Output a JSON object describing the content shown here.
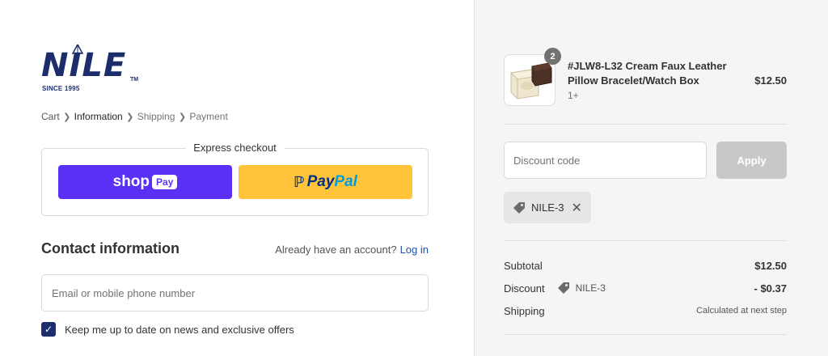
{
  "logo": {
    "word": "NILE",
    "tm": "TM",
    "since": "SINCE 1995"
  },
  "breadcrumb": [
    {
      "label": "Cart",
      "state": "link"
    },
    {
      "label": "Information",
      "state": "active"
    },
    {
      "label": "Shipping",
      "state": "muted"
    },
    {
      "label": "Payment",
      "state": "muted"
    }
  ],
  "express": {
    "title": "Express checkout",
    "shop_pay": {
      "word": "shop",
      "badge": "Pay"
    },
    "paypal": {
      "part1": "Pay",
      "part2": "Pal"
    }
  },
  "contact": {
    "title": "Contact information",
    "account_prompt": "Already have an account?",
    "login_label": "Log in",
    "email_placeholder": "Email or mobile phone number",
    "newsletter_label": "Keep me up to date on news and exclusive offers",
    "newsletter_checked": true
  },
  "order": {
    "product": {
      "name": "#JLW8-L32 Cream Faux Leather Pillow Bracelet/Watch Box",
      "variant": "1+",
      "price": "$12.50",
      "quantity": "2"
    },
    "discount": {
      "placeholder": "Discount code",
      "apply_label": "Apply",
      "applied_code": "NILE-3"
    },
    "summary": {
      "subtotal_label": "Subtotal",
      "subtotal_value": "$12.50",
      "discount_label": "Discount",
      "discount_code": "NILE-3",
      "discount_value": "- $0.37",
      "shipping_label": "Shipping",
      "shipping_value": "Calculated at next step"
    }
  },
  "colors": {
    "brand": "#1c2d6b",
    "shop_pay": "#5a31f4",
    "paypal": "#ffc439",
    "link": "#1f4fa8"
  }
}
